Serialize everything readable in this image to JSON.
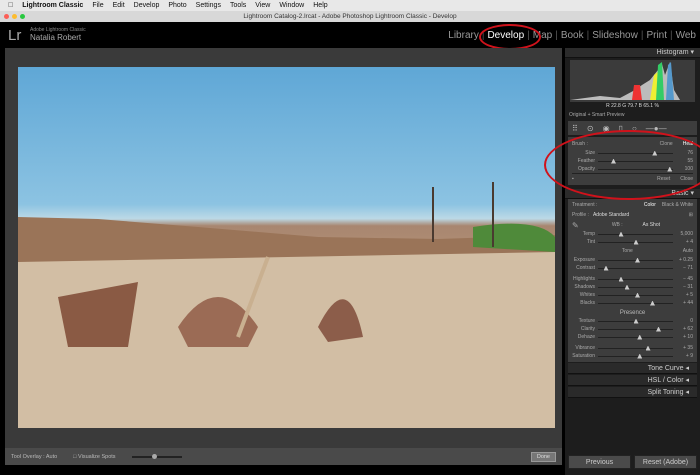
{
  "menubar": {
    "apple": "",
    "app": "Lightroom Classic",
    "items": [
      "File",
      "Edit",
      "Develop",
      "Photo",
      "Settings",
      "Tools",
      "View",
      "Window",
      "Help"
    ]
  },
  "window_title": "Lightroom Catalog-2.lrcat - Adobe Photoshop Lightroom Classic - Develop",
  "identity": {
    "logo": "Lr",
    "product": "Adobe Lightroom Classic",
    "user": "Natalia Robert"
  },
  "modules": [
    "Library",
    "Develop",
    "Map",
    "Book",
    "Slideshow",
    "Print",
    "Web"
  ],
  "active_module": "Develop",
  "toolbar": {
    "tool_overlay": "Tool Overlay : Auto",
    "visualize_spots": "Visualize Spots",
    "done": "Done"
  },
  "panel": {
    "histogram": {
      "title": "Histogram",
      "values": "R 22.8  G 79.7  B 65.1 %",
      "preview": "Original + Smart Preview"
    },
    "spot": {
      "brush_label": "Brush :",
      "clone": "Clone",
      "heal": "Heal",
      "sliders": [
        {
          "label": "Size",
          "value": "76",
          "pos": 0.75
        },
        {
          "label": "Feather",
          "value": "55",
          "pos": 0.2
        },
        {
          "label": "Opacity",
          "value": "100",
          "pos": 0.95
        }
      ],
      "reset": "Reset",
      "close": "Close"
    },
    "basic": {
      "title": "Basic",
      "treatment": "Treatment :",
      "color": "Color",
      "bw": "Black & White",
      "profile_label": "Profile :",
      "profile": "Adobe Standard",
      "wb_label": "WB :",
      "wb": "As Shot",
      "wb_sliders": [
        {
          "label": "Temp",
          "value": "5,000",
          "pos": 0.3
        },
        {
          "label": "Tint",
          "value": "+ 4",
          "pos": 0.5
        }
      ],
      "tone": "Tone",
      "auto": "Auto",
      "tone_sliders": [
        {
          "label": "Exposure",
          "value": "+ 0.25",
          "pos": 0.52
        },
        {
          "label": "Contrast",
          "value": "− 71",
          "pos": 0.1
        }
      ],
      "tone_sliders2": [
        {
          "label": "Highlights",
          "value": "− 45",
          "pos": 0.3
        },
        {
          "label": "Shadows",
          "value": "− 31",
          "pos": 0.38
        },
        {
          "label": "Whites",
          "value": "+ 5",
          "pos": 0.52
        },
        {
          "label": "Blacks",
          "value": "+ 44",
          "pos": 0.72
        }
      ],
      "presence": "Presence",
      "presence_sliders": [
        {
          "label": "Texture",
          "value": "0",
          "pos": 0.5
        },
        {
          "label": "Clarity",
          "value": "+ 62",
          "pos": 0.8
        },
        {
          "label": "Dehaze",
          "value": "+ 10",
          "pos": 0.55
        }
      ],
      "presence_sliders2": [
        {
          "label": "Vibrance",
          "value": "+ 35",
          "pos": 0.66
        },
        {
          "label": "Saturation",
          "value": "+ 9",
          "pos": 0.55
        }
      ]
    },
    "collapsed": [
      "Tone Curve",
      "HSL / Color",
      "Split Toning"
    ],
    "previous": "Previous",
    "reset_adobe": "Reset (Adobe)"
  },
  "colors": {
    "annotation": "#d0121b",
    "sky": "#5fa7d6",
    "sand": "#d6c3ac"
  }
}
